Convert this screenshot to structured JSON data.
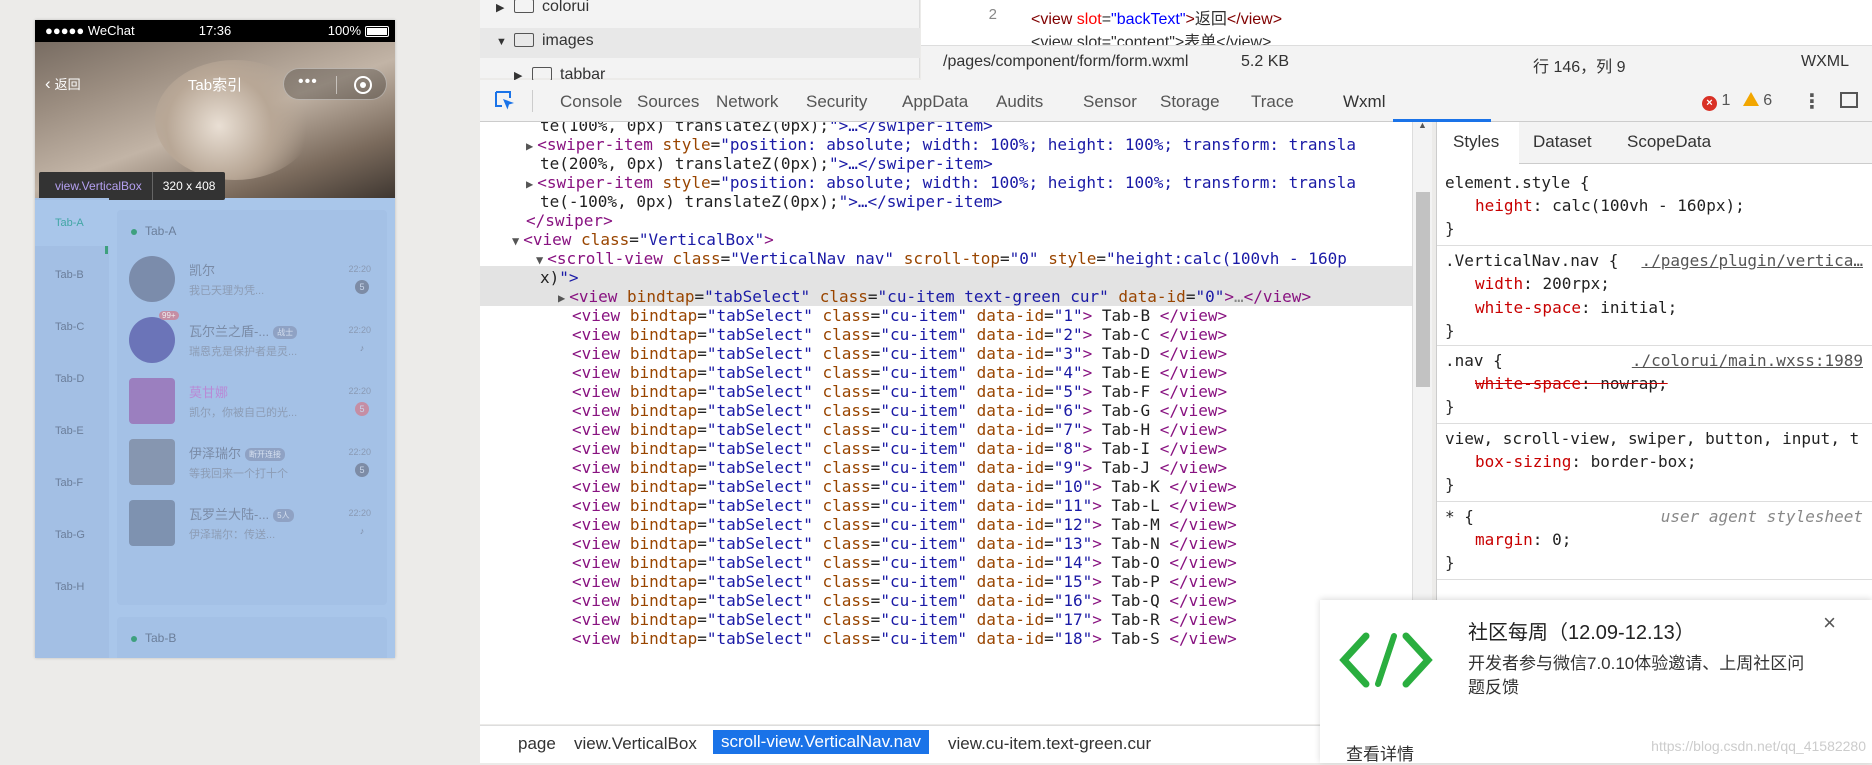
{
  "simulator": {
    "carrier": "●●●●● WeChat",
    "time": "17:36",
    "battery": "100%",
    "back_label": "返回",
    "nav_title": "Tab索引",
    "capsule_dots": "•••",
    "tooltip_name": "view.VerticalBox",
    "tooltip_size": "320 x 408",
    "left_tabs": [
      "Tab-A",
      "Tab-B",
      "Tab-C",
      "Tab-D",
      "Tab-E",
      "Tab-F",
      "Tab-G",
      "Tab-H"
    ],
    "section_a": "Tab-A",
    "section_b": "Tab-B",
    "chats": [
      {
        "name": "凯尔",
        "msg": "我已天理为凭...",
        "time": "22:20",
        "badge": "5"
      },
      {
        "name": "瓦尔兰之盾-...",
        "tag": "战士",
        "msg": "瑞恩克是保护者是灵...",
        "time": "22:20",
        "badge": "",
        "corner": "99+"
      },
      {
        "name": "莫甘娜",
        "msg": "凯尔，你被自己的光...",
        "time": "22:20",
        "badge": "5"
      },
      {
        "name": "伊泽瑞尔",
        "tag": "断开连接",
        "msg": "等我回来一个打十个",
        "time": "22:20",
        "badge": "5"
      },
      {
        "name": "瓦罗兰大陆-...",
        "tag": "5人",
        "msg": "伊泽瑞尔：传送...",
        "time": "22:20",
        "badge": ""
      }
    ]
  },
  "filetree": {
    "items": [
      "colorui",
      "images",
      "tabbar"
    ]
  },
  "editor": {
    "line_no": "2",
    "line1_tag_open": "<view ",
    "line1_attr": "slot",
    "line1_val": "\"backText\"",
    "line1_text": "返回",
    "line1_tag_close": "</view>",
    "line2_partial": "<view slot=\"content\">表单</view>"
  },
  "statusbar": {
    "path": "/pages/component/form/form.wxml",
    "size": "5.2 KB",
    "position": "行 146，列 9",
    "lang": "WXML"
  },
  "devtools": {
    "tabs": [
      "Console",
      "Sources",
      "Network",
      "Security",
      "AppData",
      "Audits",
      "Sensor",
      "Storage",
      "Trace",
      "Wxml"
    ],
    "active_tab": "Wxml",
    "errors": "1",
    "warnings": "6"
  },
  "dom": {
    "lines": [
      {
        "text": "te(100%, 0px) translateZ(0px);\">…</swiper-item>"
      },
      {
        "text": "<swiper-item style=\"position: absolute; width: 100%; height: 100%; transform: transla"
      },
      {
        "text": "te(200%, 0px) translateZ(0px);\">…</swiper-item>"
      },
      {
        "text": "<swiper-item style=\"position: absolute; width: 100%; height: 100%; transform: transla"
      },
      {
        "text": "te(-100%, 0px) translateZ(0px);\">…</swiper-item>"
      },
      {
        "text": "</swiper>"
      },
      {
        "text": "<view class=\"VerticalBox\">"
      },
      {
        "text": "<scroll-view class=\"VerticalNav nav\" scroll-top=\"0\" style=\"height:calc(100vh - 160p"
      },
      {
        "text": "x)\">"
      },
      {
        "text": "<view bindtap=\"tabSelect\" class=\"cu-item text-green cur\" data-id=\"0\">…</view>"
      }
    ],
    "items": [
      {
        "id": "1",
        "label": "Tab-B"
      },
      {
        "id": "2",
        "label": "Tab-C"
      },
      {
        "id": "3",
        "label": "Tab-D"
      },
      {
        "id": "4",
        "label": "Tab-E"
      },
      {
        "id": "5",
        "label": "Tab-F"
      },
      {
        "id": "6",
        "label": "Tab-G"
      },
      {
        "id": "7",
        "label": "Tab-H"
      },
      {
        "id": "8",
        "label": "Tab-I"
      },
      {
        "id": "9",
        "label": "Tab-J"
      },
      {
        "id": "10",
        "label": "Tab-K"
      },
      {
        "id": "11",
        "label": "Tab-L"
      },
      {
        "id": "12",
        "label": "Tab-M"
      },
      {
        "id": "13",
        "label": "Tab-N"
      },
      {
        "id": "14",
        "label": "Tab-O"
      },
      {
        "id": "15",
        "label": "Tab-P"
      },
      {
        "id": "16",
        "label": "Tab-Q"
      },
      {
        "id": "17",
        "label": "Tab-R"
      },
      {
        "id": "18",
        "label": "Tab-S"
      }
    ]
  },
  "breadcrumb": [
    "page",
    "view.VerticalBox",
    "scroll-view.VerticalNav.nav",
    "view.cu-item.text-green.cur"
  ],
  "styles": {
    "tabs": [
      "Styles",
      "Dataset",
      "ScopeData"
    ],
    "rules": [
      {
        "selector": "element.style {",
        "source": "",
        "props": [
          {
            "name": "height",
            "value": "calc(100vh - 160px);"
          }
        ]
      },
      {
        "selector": ".VerticalNav.nav {",
        "source": "./pages/plugin/vertica…",
        "props": [
          {
            "name": "width",
            "value": "200rpx;"
          },
          {
            "name": "white-space",
            "value": "initial;"
          }
        ]
      },
      {
        "selector": ".nav {",
        "source": "./colorui/main.wxss:1989",
        "props": [
          {
            "name": "white-space",
            "value": "nowrap;",
            "struck": true
          }
        ]
      },
      {
        "selector": "view, scroll-view, swiper, button, input, t",
        "source": "",
        "props": [
          {
            "name": "box-sizing",
            "value": "border-box;"
          }
        ]
      },
      {
        "selector": "* {",
        "source": "user agent stylesheet",
        "props": [
          {
            "name": "margin",
            "value": "0;"
          }
        ]
      }
    ],
    "close_brace": "}"
  },
  "notification": {
    "title": "社区每周（12.09-12.13）",
    "body": "开发者参与微信7.0.10体验邀请、上周社区问题反馈",
    "more": "查看详情",
    "close": "×",
    "watermark": "https://blog.csdn.net/qq_41582280"
  }
}
